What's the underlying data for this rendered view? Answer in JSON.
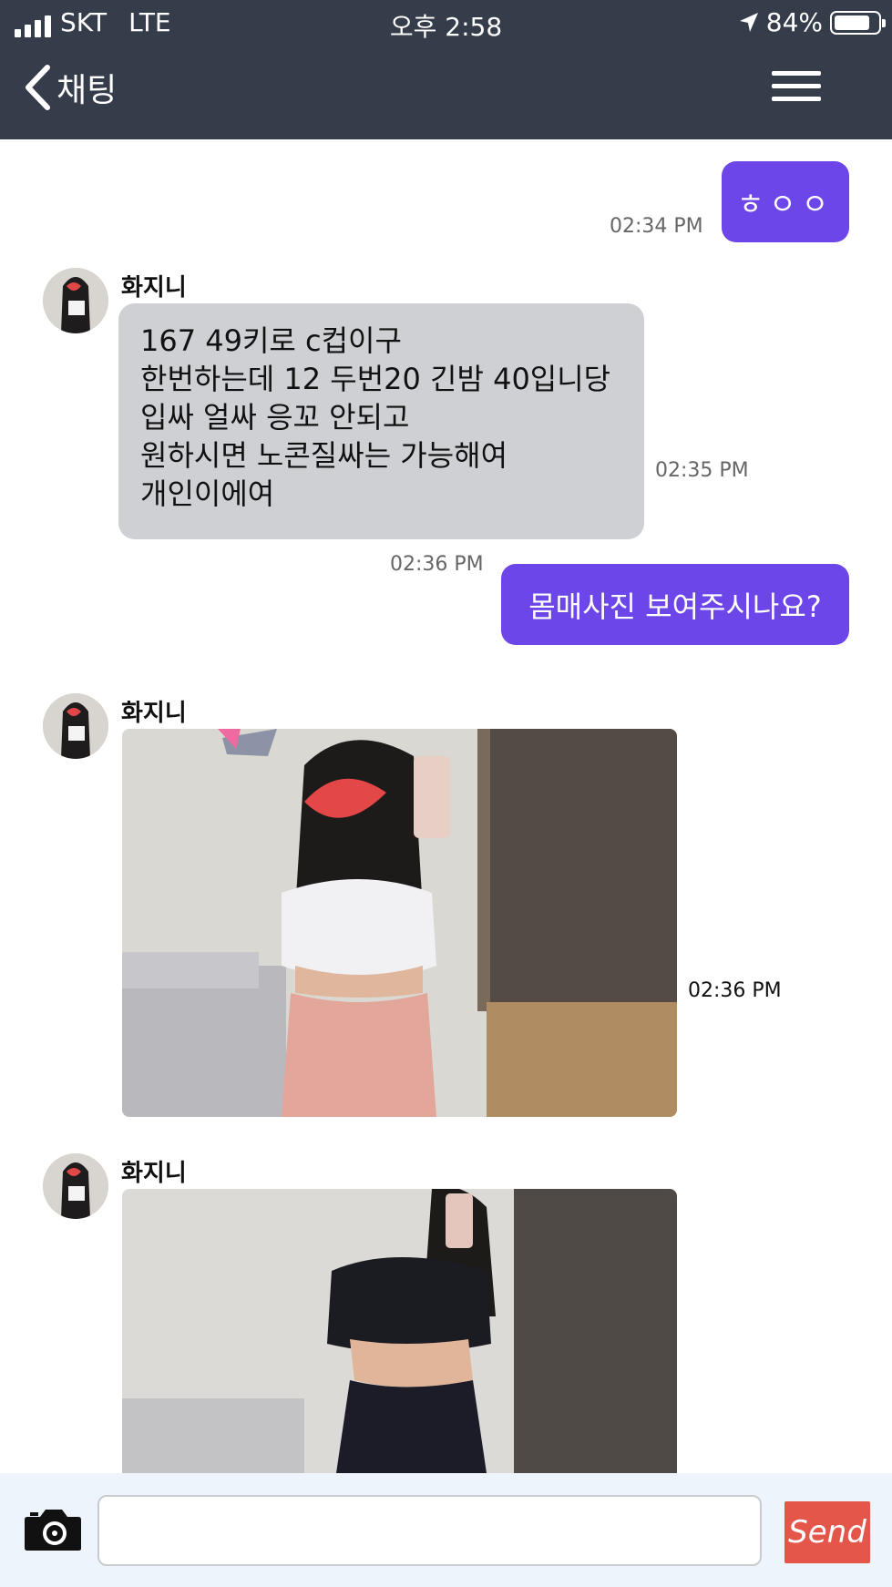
{
  "status_bar": {
    "carrier": "SKT",
    "network": "LTE",
    "time": "오후 2:58",
    "battery": "84%"
  },
  "nav": {
    "title": "채팅",
    "back_icon": "chevron-left-icon",
    "menu_icon": "hamburger-menu-icon"
  },
  "messages": [
    {
      "type": "outgoing",
      "text": "ㅎㅇㅇ",
      "time": "02:34 PM"
    },
    {
      "type": "incoming",
      "sender": "화지니",
      "lines": [
        "167 49키로 c컵이구",
        "한번하는데 12 두번20 긴밤 40입니당",
        "입싸 얼싸 응꼬 안되고",
        "원하시면 노콘질싸는 가능해여",
        "개인이에여"
      ],
      "time": "02:35 PM"
    },
    {
      "type": "outgoing",
      "text": "몸매사진 보여주시나요?",
      "time": "02:36 PM"
    },
    {
      "type": "incoming-photo",
      "sender": "화지니",
      "time": "02:36 PM"
    },
    {
      "type": "incoming-photo",
      "sender": "화지니",
      "time": ""
    }
  ],
  "composer": {
    "placeholder": "",
    "send_label": "Send",
    "camera_icon": "camera-icon"
  },
  "colors": {
    "header_bg": "#353c4a",
    "outgoing_bubble": "#6c46e8",
    "incoming_bubble": "#cfd0d4",
    "send_button": "#e5564a",
    "composer_bg": "#eef4fb"
  }
}
